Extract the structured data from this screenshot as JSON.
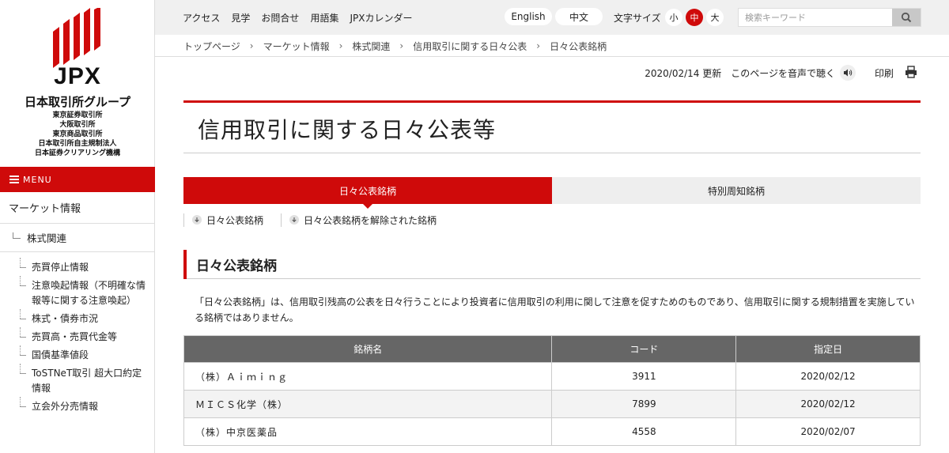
{
  "logo": {
    "jpx": "JPX",
    "group": "日本取引所グループ",
    "subsidiaries": [
      "東京証券取引所",
      "大阪取引所",
      "東京商品取引所",
      "日本取引所自主規制法人",
      "日本証券クリアリング機構"
    ]
  },
  "menu": {
    "label": "MENU"
  },
  "sidebar": {
    "top": "マーケット情報",
    "sub": "株式関連",
    "items": [
      "売買停止情報",
      "注意喚起情報（不明確な情報等に関する注意喚起）",
      "株式・債券市況",
      "売買高・売買代金等",
      "国債基準値段",
      "ToSTNeT取引 超大口約定情報",
      "立会外分売情報"
    ]
  },
  "topnav": {
    "links": [
      "アクセス",
      "見学",
      "お問合せ",
      "用語集",
      "JPXカレンダー"
    ],
    "english": "English",
    "chinese": "中文",
    "font_size_label": "文字サイズ",
    "font_sizes": [
      "小",
      "中",
      "大"
    ],
    "search_placeholder": "検索キーワード"
  },
  "breadcrumb": [
    "トップページ",
    "マーケット情報",
    "株式関連",
    "信用取引に関する日々公表",
    "日々公表銘柄"
  ],
  "utility": {
    "updated": "2020/02/14 更新",
    "listen": "このページを音声で聴く",
    "print": "印刷"
  },
  "page_title": "信用取引に関する日々公表等",
  "tabs": [
    "日々公表銘柄",
    "特別周知銘柄"
  ],
  "anchors": [
    "日々公表銘柄",
    "日々公表銘柄を解除された銘柄"
  ],
  "section": {
    "heading": "日々公表銘柄",
    "description": "「日々公表銘柄」は、信用取引残高の公表を日々行うことにより投資者に信用取引の利用に関して注意を促すためのものであり、信用取引に関する規制措置を実施している銘柄ではありません。"
  },
  "table": {
    "headers": [
      "銘柄名",
      "コード",
      "指定日"
    ],
    "rows": [
      [
        "（株）Ａｉｍｉｎｇ",
        "3911",
        "2020/02/12"
      ],
      [
        "ＭＩＣＳ化学（株）",
        "7899",
        "2020/02/12"
      ],
      [
        "（株）中京医薬品",
        "4558",
        "2020/02/07"
      ]
    ]
  },
  "colors": {
    "brand_red": "#cf0a0a",
    "table_header": "#666666"
  }
}
